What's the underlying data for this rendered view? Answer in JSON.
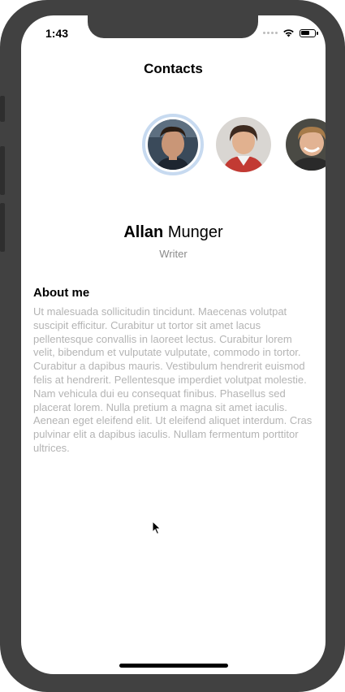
{
  "status_bar": {
    "time": "1:43"
  },
  "nav": {
    "title": "Contacts"
  },
  "contacts": [
    {
      "icon": "avatar-allan",
      "selected": true
    },
    {
      "icon": "avatar-contact-2",
      "selected": false
    },
    {
      "icon": "avatar-contact-3",
      "selected": false
    }
  ],
  "profile": {
    "first_name": "Allan",
    "last_name": "Munger",
    "role": "Writer",
    "about_title": "About me",
    "about_text": "Ut malesuada sollicitudin tincidunt. Maecenas volutpat suscipit efficitur. Curabitur ut tortor sit amet lacus pellentesque convallis in laoreet lectus. Curabitur lorem velit, bibendum et vulputate vulputate, commodo in tortor. Curabitur a dapibus mauris. Vestibulum hendrerit euismod felis at hendrerit. Pellentesque imperdiet volutpat molestie. Nam vehicula dui eu consequat finibus. Phasellus sed placerat lorem. Nulla pretium a magna sit amet iaculis. Aenean eget eleifend elit. Ut eleifend aliquet interdum. Cras pulvinar elit a dapibus iaculis. Nullam fermentum porttitor ultrices."
  },
  "colors": {
    "selected_ring": "#c7daf0",
    "secondary_text": "#8a8a8a",
    "body_text": "#b4b4b4",
    "bezel": "#414141"
  }
}
